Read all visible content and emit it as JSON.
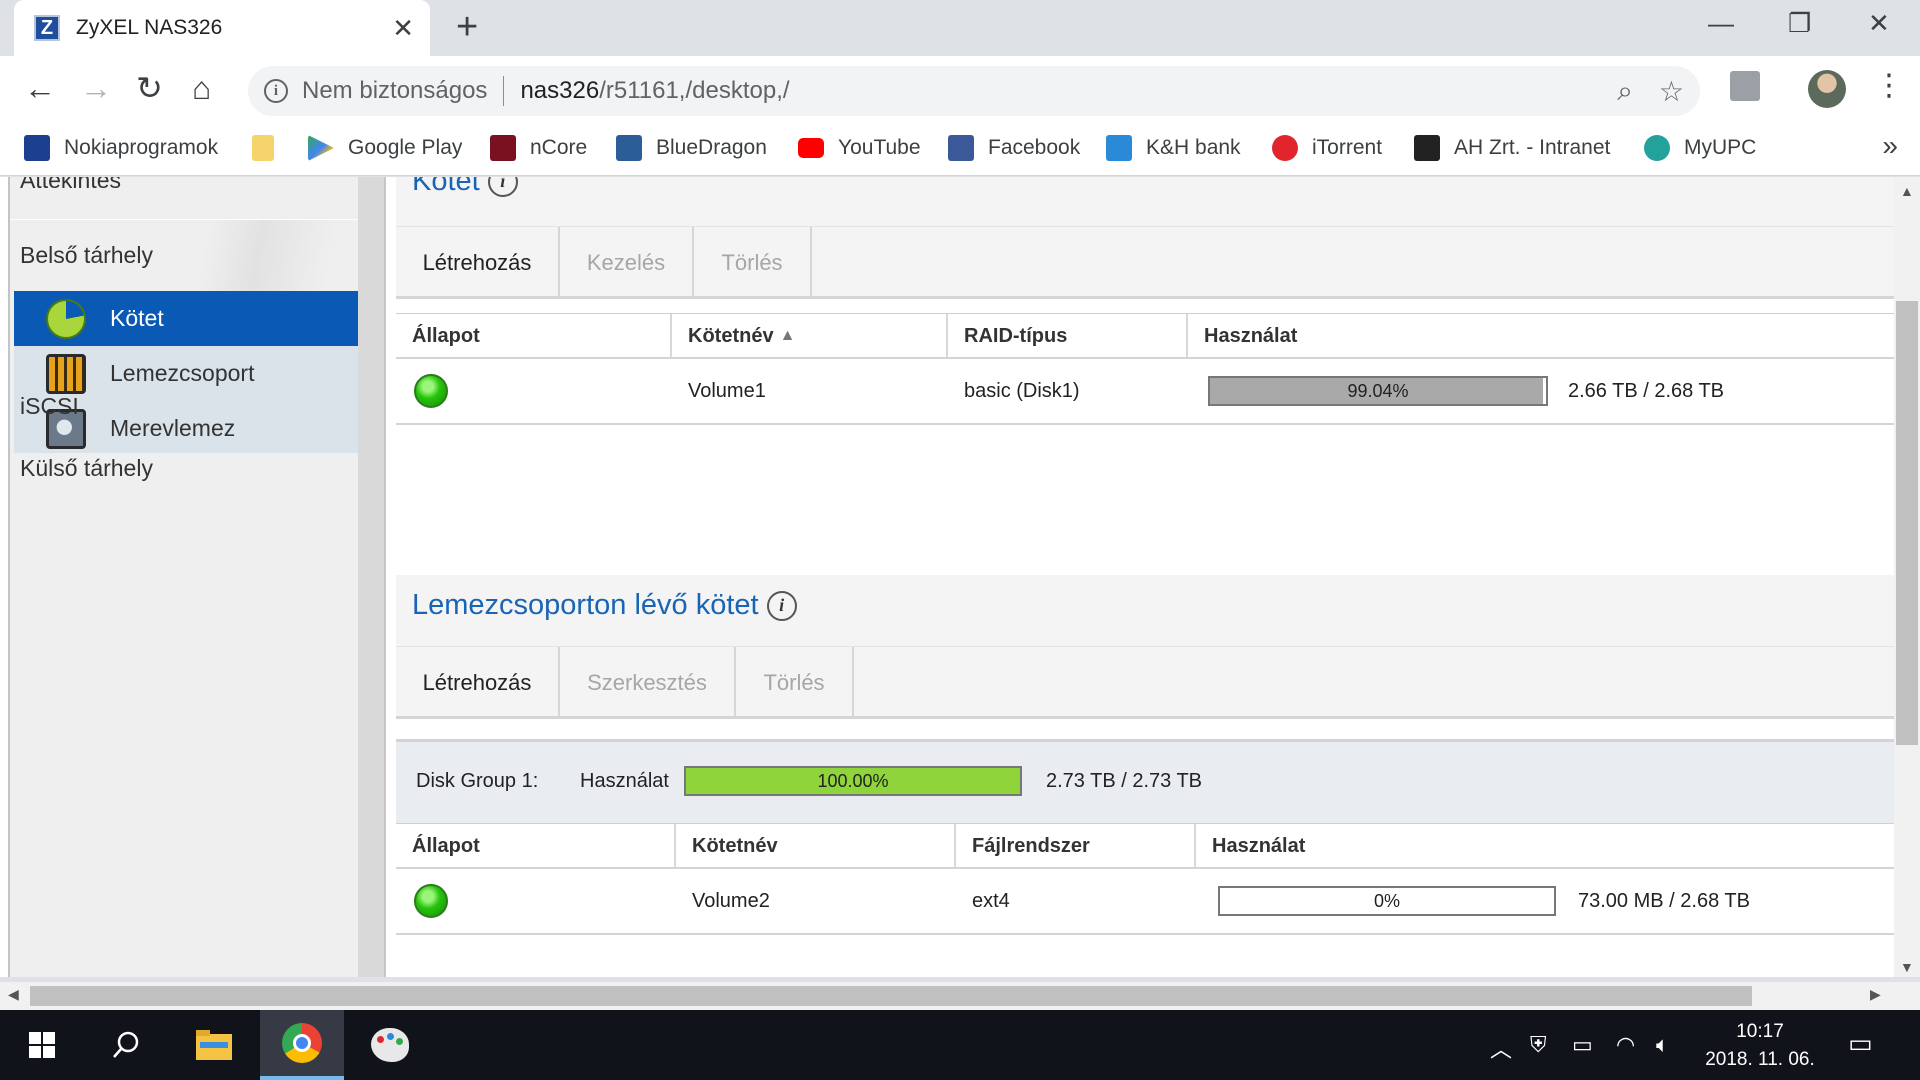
{
  "browser": {
    "tab_title": "ZyXEL NAS326",
    "tab_favicon_letter": "Z",
    "security_label": "Nem biztonságos",
    "url_host": "nas326",
    "url_path": "/r51161,/desktop,/",
    "bookmarks": [
      {
        "label": "Nokiaprogramok",
        "icon": "np-icon",
        "color": "#1d3f8f"
      },
      {
        "label": "",
        "icon": "folder-icon",
        "color": "#f6d36b"
      },
      {
        "label": "Google Play",
        "icon": "play-icon",
        "color": "#34a853"
      },
      {
        "label": "nCore",
        "icon": "ncore-icon",
        "color": "#7a1120"
      },
      {
        "label": "BlueDragon",
        "icon": "bluedragon-icon",
        "color": "#2b5e96"
      },
      {
        "label": "YouTube",
        "icon": "youtube-icon",
        "color": "#ff0000"
      },
      {
        "label": "Facebook",
        "icon": "facebook-icon",
        "color": "#3b5998"
      },
      {
        "label": "K&H bank",
        "icon": "kh-icon",
        "color": "#2a8ad8"
      },
      {
        "label": "iTorrent",
        "icon": "itorrent-icon",
        "color": "#e0262c"
      },
      {
        "label": "AH Zrt. - Intranet",
        "icon": "liga-icon",
        "color": "#222222"
      },
      {
        "label": "MyUPC",
        "icon": "upc-icon",
        "color": "#22a29a"
      }
    ]
  },
  "sidebar": {
    "top_item": "Áttekintés",
    "section_internal": "Belső tárhely",
    "sub_items": [
      {
        "label": "Kötet",
        "icon": "pie-chart-icon"
      },
      {
        "label": "Lemezcsoport",
        "icon": "disk-group-icon"
      },
      {
        "label": "Merevlemez",
        "icon": "hard-disk-icon"
      }
    ],
    "iscsi": "iSCSI",
    "external": "Külső tárhely"
  },
  "volume_section": {
    "title": "Kötet",
    "tabs": [
      "Létrehozás",
      "Kezelés",
      "Törlés"
    ],
    "columns": [
      "Állapot",
      "Kötetnév",
      "RAID-típus",
      "Használat"
    ],
    "sort_indicator": "▲",
    "rows": [
      {
        "status": "ok",
        "name": "Volume1",
        "raid": "basic (Disk1)",
        "usage_percent": 99.04,
        "usage_label": "99.04%",
        "capacity": "2.66 TB / 2.68 TB"
      }
    ]
  },
  "diskgroup_section": {
    "title": "Lemezcsoporton lévő kötet",
    "tabs": [
      "Létrehozás",
      "Szerkesztés",
      "Törlés"
    ],
    "group_label": "Disk Group 1:",
    "usage_label": "Használat",
    "group_percent": 100,
    "group_percent_label": "100.00%",
    "group_capacity": "2.73 TB / 2.73 TB",
    "columns": [
      "Állapot",
      "Kötetnév",
      "Fájlrendszer",
      "Használat"
    ],
    "rows": [
      {
        "status": "ok",
        "name": "Volume2",
        "filesystem": "ext4",
        "usage_percent": 0,
        "usage_label": "0%",
        "capacity": "73.00 MB / 2.68 TB"
      }
    ]
  },
  "colors": {
    "accent": "#0a5ab5",
    "title_blue": "#1a64b3",
    "usage_gray": "#a9a9a9",
    "usage_green": "#8fd43b"
  },
  "taskbar": {
    "time": "10:17",
    "date": "2018. 11. 06."
  }
}
